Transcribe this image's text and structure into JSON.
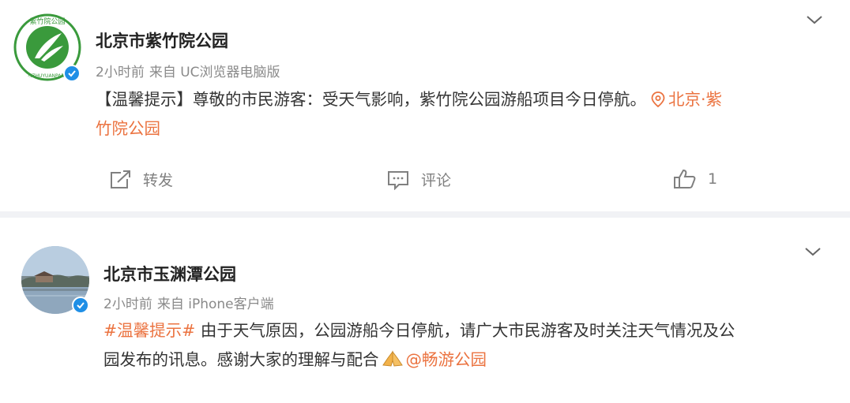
{
  "posts": [
    {
      "name": "北京市紫竹院公园",
      "time": "2小时前",
      "source": "来自 UC浏览器电脑版",
      "text": "【温馨提示】尊敬的市民游客：受天气影响，紫竹院公园游船项目今日停航。",
      "location_line1": "北京·紫",
      "location_line2": "竹院公园",
      "actions": {
        "repost": "转发",
        "comment": "评论",
        "like_count": "1"
      },
      "logo_text": "紫竹院公园",
      "logo_text_bottom": "ZIZHUYUANPARK"
    },
    {
      "name": "北京市玉渊潭公园",
      "time": "2小时前",
      "source": "来自 iPhone客户端",
      "hashtag": "#温馨提示#",
      "text_line1": " 由于天气原因，公园游船今日停航，请广大市民游客及时关注天气情况及公",
      "text_line2": "园发布的讯息。感谢大家的理解与配合",
      "mention": "@畅游公园"
    }
  ],
  "colors": {
    "accent": "#eb7340",
    "verified": "#1f8fe6",
    "logo_green": "#3a9a3c"
  }
}
